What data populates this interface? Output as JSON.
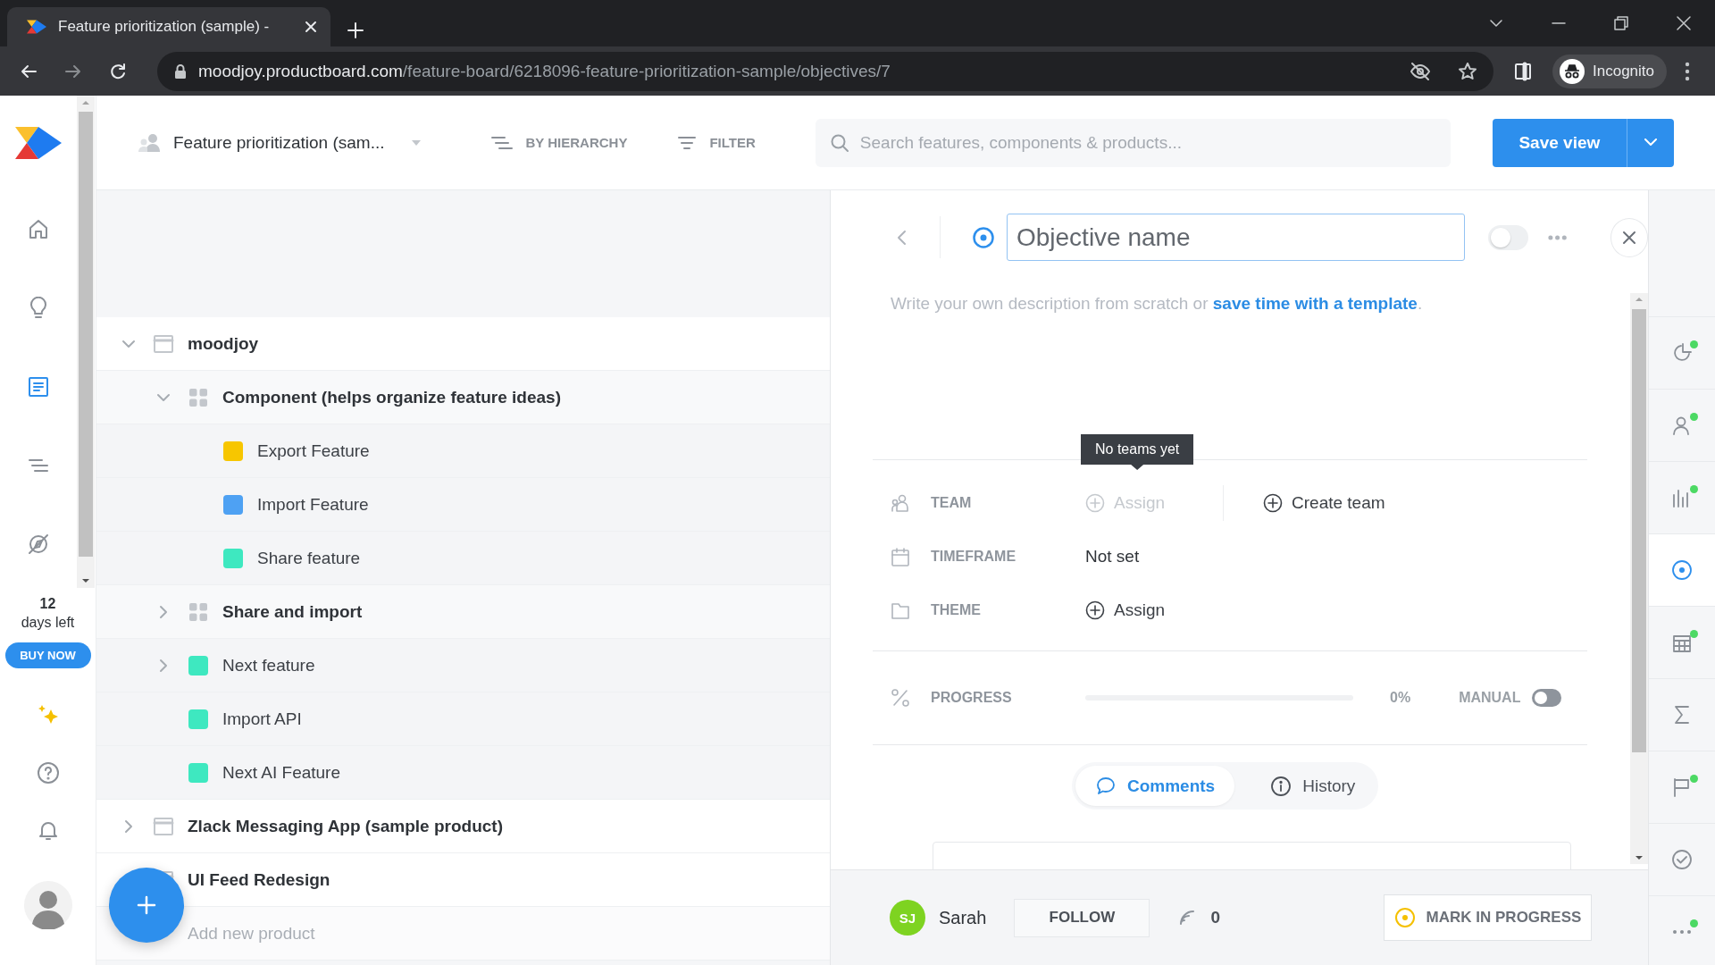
{
  "browser": {
    "tab_title": "Feature prioritization (sample) -",
    "url_host": "moodjoy.productboard.com",
    "url_path": "/feature-board/6218096-feature-prioritization-sample/objectives/7",
    "profile": "Incognito"
  },
  "nav": {
    "items": [
      {
        "selected": false
      },
      {
        "selected": false
      },
      {
        "selected": true
      },
      {
        "selected": false
      },
      {
        "selected": false
      }
    ],
    "trial_days": "12",
    "trial_label": "days left",
    "buy": "BUY NOW"
  },
  "toolbar": {
    "board": "Feature prioritization (sam...",
    "hierarchy": "BY HIERARCHY",
    "filter": "FILTER",
    "search_placeholder": "Search features, components & products...",
    "save": "Save view"
  },
  "tree": {
    "items": [
      {
        "kind": "product",
        "name": "moodjoy",
        "expanded": true,
        "children": [
          {
            "kind": "component",
            "name": "Component (helps organize feature ideas)",
            "expanded": true,
            "children": [
              {
                "kind": "feature",
                "name": "Export Feature",
                "color": "#f7c600"
              },
              {
                "kind": "feature",
                "name": "Import Feature",
                "color": "#4ea1f3"
              },
              {
                "kind": "feature",
                "name": "Share feature",
                "color": "#3ee8c0"
              }
            ]
          },
          {
            "kind": "component",
            "name": "Share and import",
            "expanded": false
          },
          {
            "kind": "feature",
            "name": "Next feature",
            "color": "#3ee8c0",
            "expanded": false
          },
          {
            "kind": "feature",
            "name": "Import API",
            "color": "#3ee8c0"
          },
          {
            "kind": "feature",
            "name": "Next AI Feature",
            "color": "#3ee8c0"
          }
        ]
      },
      {
        "kind": "product",
        "name": "Zlack Messaging App (sample product)",
        "expanded": false
      },
      {
        "kind": "product",
        "name": "UI Feed Redesign"
      }
    ],
    "add_placeholder": "Add new product"
  },
  "detail": {
    "name_placeholder": "Objective name",
    "status_on": false,
    "description": "Write your own description from scratch or ",
    "template_link": "save time with a template",
    "description_end": ".",
    "tooltip": "No teams yet",
    "fields": [
      {
        "kind": "assign",
        "label": "TEAM",
        "value": "Assign",
        "disabled": true,
        "action": "Create team"
      },
      {
        "kind": "text",
        "label": "TIMEFRAME",
        "value": "Not set"
      },
      {
        "kind": "assign",
        "label": "THEME",
        "value": "Assign",
        "disabled": false
      }
    ],
    "progress": {
      "label": "PROGRESS",
      "level": 0,
      "reading": "0%",
      "manual_label": "MANUAL",
      "manual_on": false
    },
    "tabs": [
      {
        "label": "Comments",
        "selected": true
      },
      {
        "label": "History",
        "selected": false
      }
    ],
    "footer": {
      "initials": "SJ",
      "user": "Sarah",
      "follow": "FOLLOW",
      "followers": "0",
      "mark_button": "MARK IN PROGRESS"
    }
  },
  "rail": {
    "items": [
      {
        "selected": false,
        "badge": true
      },
      {
        "selected": false,
        "badge": true
      },
      {
        "selected": false,
        "badge": true
      },
      {
        "selected": true,
        "badge": false
      },
      {
        "selected": false,
        "badge": true
      },
      {
        "selected": false,
        "badge": false
      },
      {
        "selected": false,
        "badge": true
      },
      {
        "selected": false,
        "badge": false
      },
      {
        "selected": false,
        "badge": true
      }
    ]
  }
}
